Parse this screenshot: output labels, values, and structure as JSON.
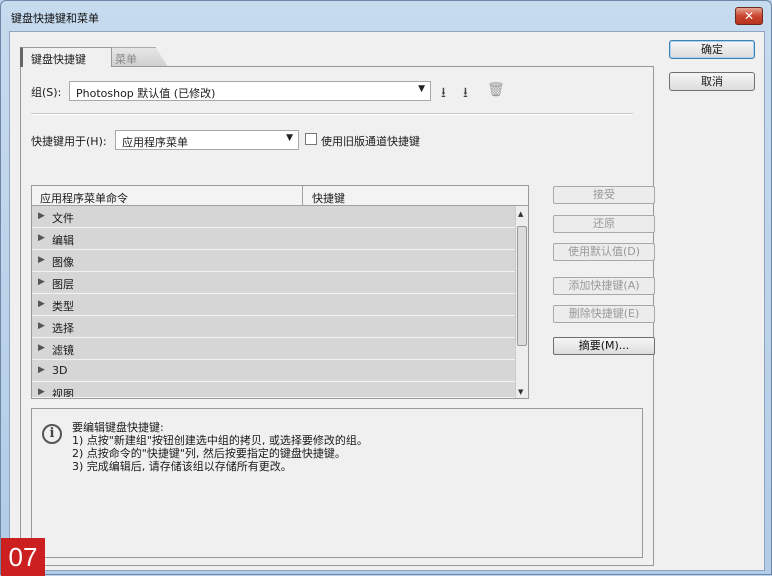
{
  "window": {
    "title": "键盘快捷键和菜单",
    "close_label": "✕"
  },
  "tabs": [
    {
      "label": "键盘快捷键"
    },
    {
      "label": "菜单"
    }
  ],
  "group": {
    "label": "组(S):",
    "value": "Photoshop 默认值 (已修改)"
  },
  "group_icons": [
    "save-icon",
    "save-as-icon",
    "trash-icon"
  ],
  "shortcuts_for": {
    "label": "快捷键用于(H):",
    "value": "应用程序菜单"
  },
  "legacy_checkbox": {
    "label": "使用旧版通道快捷键",
    "checked": false
  },
  "table": {
    "columns": [
      "应用程序菜单命令",
      "快捷键"
    ],
    "rows": [
      "文件",
      "编辑",
      "图像",
      "图层",
      "类型",
      "选择",
      "滤镜",
      "3D",
      "视图"
    ]
  },
  "side_buttons": [
    {
      "label": "接受",
      "enabled": false
    },
    {
      "label": "还原",
      "enabled": false
    },
    {
      "label": "使用默认值(D)",
      "enabled": false
    },
    {
      "label": "添加快捷键(A)",
      "enabled": false
    },
    {
      "label": "删除快捷键(E)",
      "enabled": false
    },
    {
      "label": "摘要(M)...",
      "enabled": true
    }
  ],
  "info": {
    "lines": [
      "要编辑键盘快捷键:",
      "1) 点按\"新建组\"按钮创建选中组的拷贝, 或选择要修改的组。",
      "2) 点按命令的\"快捷键\"列, 然后按要指定的键盘快捷键。",
      "3) 完成编辑后, 请存储该组以存储所有更改。"
    ]
  },
  "dialog_buttons": {
    "ok": "确定",
    "cancel": "取消"
  },
  "badge": "07"
}
